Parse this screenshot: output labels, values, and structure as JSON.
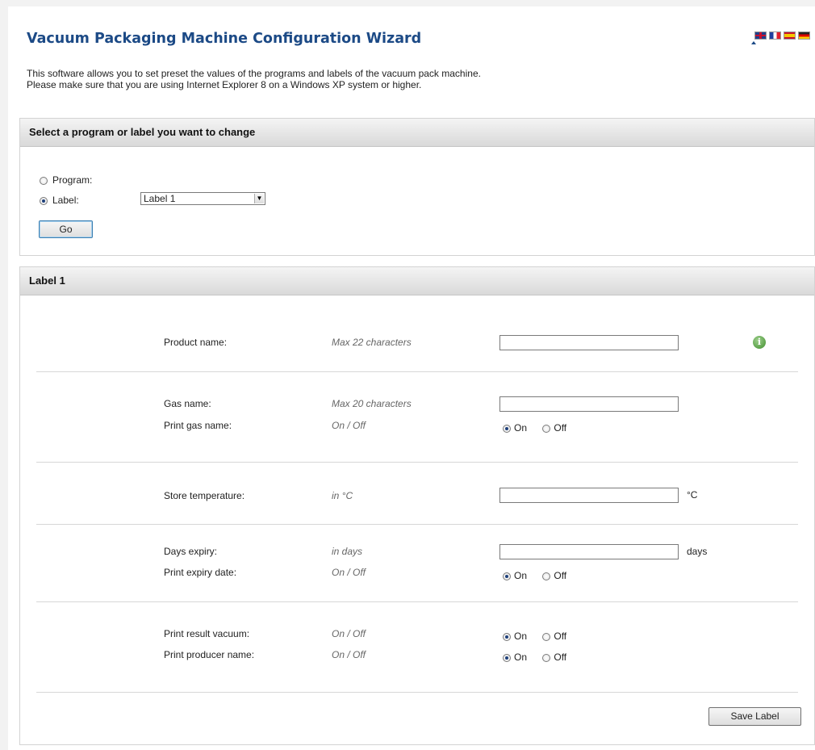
{
  "header": {
    "title": "Vacuum Packaging Machine Configuration Wizard",
    "intro_line1": "This software allows you to set preset the values of the programs and labels of the vacuum pack machine.",
    "intro_line2": "Please make sure that you are using Internet Explorer 8 on a Windows XP system or higher.",
    "languages": [
      "English",
      "French",
      "Spanish",
      "German"
    ],
    "selected_language": "English"
  },
  "selection_panel": {
    "heading": "Select a program or label you want to change",
    "program_label": "Program:",
    "label_label": "Label:",
    "selected_option": "label",
    "label_select_value": "Label 1",
    "go_button": "Go"
  },
  "label_panel": {
    "heading": "Label 1",
    "fields": {
      "product_name": {
        "label": "Product name:",
        "hint": "Max 22 characters",
        "value": ""
      },
      "gas_name": {
        "label": "Gas name:",
        "hint": "Max 20 characters",
        "value": ""
      },
      "print_gas_name": {
        "label": "Print gas name:",
        "hint": "On / Off",
        "value": "On"
      },
      "store_temperature": {
        "label": "Store temperature:",
        "hint": "in °C",
        "unit": "°C",
        "value": ""
      },
      "days_expiry": {
        "label": "Days expiry:",
        "hint": "in days",
        "unit": "days",
        "value": ""
      },
      "print_expiry_date": {
        "label": "Print expiry date:",
        "hint": "On / Off",
        "value": "On"
      },
      "print_result_vacuum": {
        "label": "Print result vacuum:",
        "hint": "On / Off",
        "value": "On"
      },
      "print_producer_name": {
        "label": "Print producer name:",
        "hint": "On / Off",
        "value": "On"
      }
    },
    "on_label": "On",
    "off_label": "Off",
    "save_button": "Save Label"
  },
  "icons": {
    "info": "info-icon",
    "flags": [
      "flag-uk-icon",
      "flag-fr-icon",
      "flag-es-icon",
      "flag-de-icon"
    ]
  },
  "colors": {
    "title": "#1c4a86",
    "panel_header": "#d9d9d9"
  }
}
